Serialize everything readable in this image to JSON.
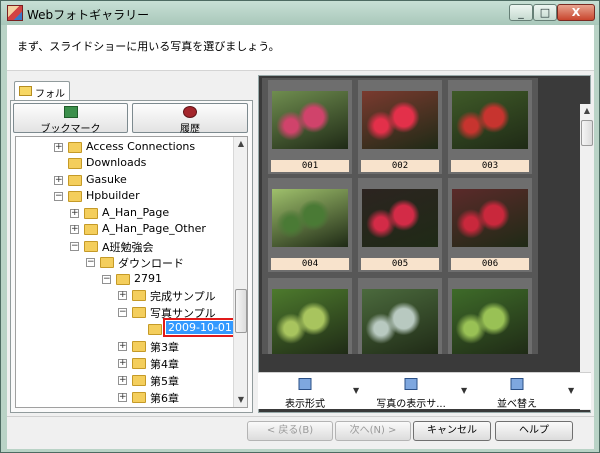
{
  "window": {
    "title": "Webフォトギャラリー",
    "min_glyph": "_",
    "max_glyph": "□",
    "close_glyph": "X"
  },
  "header": {
    "instruction": "まず、スライドショーに用いる写真を選びましょう。"
  },
  "left_tab": {
    "label": "フォルダ"
  },
  "tools": {
    "bookmark": "ブックマーク",
    "history": "履歴"
  },
  "tree": {
    "items": [
      {
        "label": "Access Connections",
        "expander": "+"
      },
      {
        "label": "Downloads",
        "expander": ""
      },
      {
        "label": "Gasuke",
        "expander": "+"
      },
      {
        "label": "Hpbuilder",
        "expander": "−"
      },
      {
        "label": "A_Han_Page",
        "expander": "+"
      },
      {
        "label": "A_Han_Page_Other",
        "expander": "+"
      },
      {
        "label": "A班勉強会",
        "expander": "−"
      },
      {
        "label": "ダウンロード",
        "expander": "−"
      },
      {
        "label": "2791",
        "expander": "−"
      },
      {
        "label": "完成サンプル",
        "expander": "+"
      },
      {
        "label": "写真サンプル",
        "expander": "−"
      },
      {
        "label": "2009-10-01",
        "expander": ""
      },
      {
        "label": "第3章",
        "expander": "+"
      },
      {
        "label": "第4章",
        "expander": "+"
      },
      {
        "label": "第5章",
        "expander": "+"
      },
      {
        "label": "第6章",
        "expander": "+"
      }
    ]
  },
  "gallery": {
    "thumbnails": [
      {
        "caption": "001",
        "colors": [
          "#6f8d4f",
          "#d0436b"
        ]
      },
      {
        "caption": "002",
        "colors": [
          "#7a3a2f",
          "#e3304a"
        ]
      },
      {
        "caption": "003",
        "colors": [
          "#3f5a28",
          "#c7342f"
        ]
      },
      {
        "caption": "004",
        "colors": [
          "#9fc06c",
          "#4a7a35"
        ]
      },
      {
        "caption": "005",
        "colors": [
          "#2c2420",
          "#d32b47"
        ]
      },
      {
        "caption": "006",
        "colors": [
          "#5b2a2a",
          "#c9283c"
        ]
      },
      {
        "caption": "",
        "colors": [
          "#4d7a2d",
          "#a8c45e"
        ]
      },
      {
        "caption": "",
        "colors": [
          "#4b6a3d",
          "#b8c9c0"
        ]
      },
      {
        "caption": "",
        "colors": [
          "#3e6b29",
          "#99c155"
        ]
      }
    ]
  },
  "gallery_toolbar": {
    "view_mode": "表示形式",
    "photo_display": "写真の表示サ...",
    "sort": "並べ替え",
    "drop_glyph": "▼"
  },
  "footer": {
    "back": "< 戻る(B)",
    "next": "次へ(N) >",
    "cancel": "キャンセル",
    "help": "ヘルプ"
  },
  "scroll": {
    "up": "▲",
    "down": "▼",
    "grip": "≡"
  }
}
